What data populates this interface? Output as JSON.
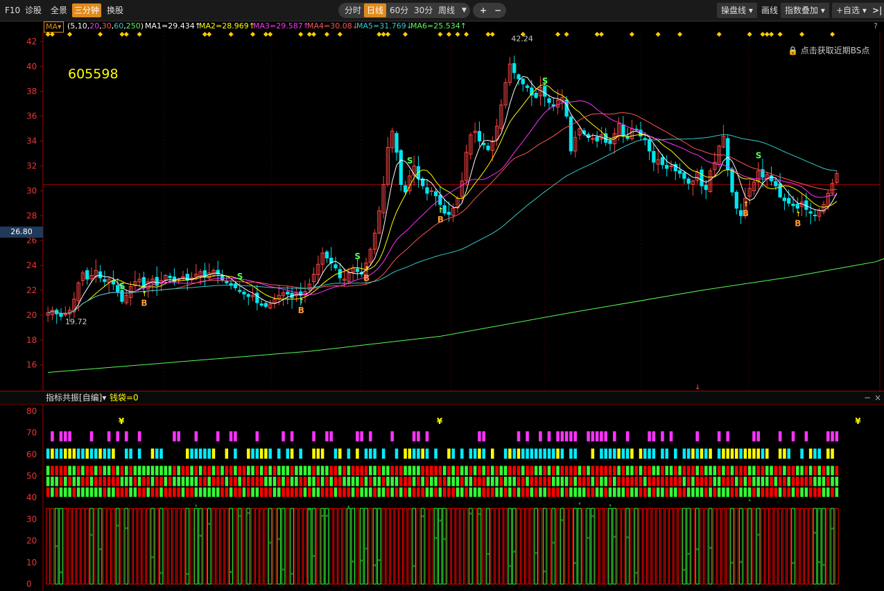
{
  "toolbar": {
    "left_items": [
      "F10",
      "诊股",
      "全景",
      "三分钟",
      "换股"
    ],
    "active_left": "三分钟",
    "periods": [
      "分时",
      "日线",
      "60分",
      "30分",
      "周线"
    ],
    "selected_period": "日线",
    "zoom_in": "+",
    "zoom_out": "−",
    "right_buttons": [
      "操盘线",
      "画线",
      "指数叠加",
      "+自选"
    ],
    "expand": ">|"
  },
  "ma_bar": {
    "indicator": "MA",
    "params_prefix": "(5,10,",
    "p3": "20",
    "p4": "30",
    "p5": "60",
    "p6": "250",
    "params_suffix": ")",
    "ma1": "MA1=29.434↑",
    "ma2": "MA2=28.969↑",
    "ma3": "MA3=29.587↑",
    "ma4": "MA4=30.08↓",
    "ma5": "MA5=31.769↓",
    "ma6": "MA6=25.534↑",
    "help": "?"
  },
  "stock_code": "605598",
  "bs_hint": "点击获取近期BS点",
  "current_price_tag": "26.80",
  "price_axis": [
    "42",
    "40",
    "38",
    "36",
    "34",
    "32",
    "30",
    "28",
    "26",
    "24",
    "22",
    "20",
    "18",
    "16"
  ],
  "extremes": {
    "high": "42.24",
    "low": "19.72"
  },
  "signal_labels": {
    "buy": "B",
    "sell": "S"
  },
  "indicator_bar": {
    "name": "指标共振[自编]",
    "value": "钱袋=0",
    "minimize": "−",
    "close": "×"
  },
  "indicator_axis": [
    "80",
    "70",
    "60",
    "50",
    "40",
    "30",
    "20",
    "10",
    "0"
  ],
  "yen_mark": "¥",
  "colors": {
    "up": "#ff4444",
    "down": "#00e5ee",
    "ma1": "#ffffff",
    "ma2": "#ffff00",
    "ma3": "#ff33ff",
    "ma4": "#ff5555",
    "ma5": "#33cccc",
    "ma6": "#55ff55",
    "accent": "#e08a1e"
  },
  "chart_data": {
    "type": "candlestick",
    "ylim": [
      15,
      43
    ],
    "closes": [
      20.2,
      20.4,
      20.1,
      19.9,
      20.1,
      20.4,
      21.3,
      22.6,
      23.4,
      22.9,
      23.2,
      23.6,
      23.0,
      22.7,
      22.9,
      22.5,
      21.9,
      21.1,
      21.6,
      22.3,
      22.7,
      22.9,
      22.2,
      22.7,
      22.9,
      22.4,
      22.8,
      23.2,
      23.0,
      22.7,
      22.9,
      23.1,
      22.8,
      23.0,
      23.3,
      23.5,
      23.1,
      23.4,
      23.6,
      23.3,
      22.8,
      22.6,
      22.4,
      22.2,
      21.9,
      21.7,
      21.5,
      21.6,
      21.0,
      20.8,
      20.7,
      20.9,
      21.3,
      21.6,
      21.8,
      21.7,
      21.4,
      21.8,
      21.6,
      21.9,
      22.5,
      23.3,
      24.1,
      25.0,
      24.6,
      24.2,
      23.8,
      23.0,
      22.9,
      23.4,
      23.8,
      23.5,
      23.3,
      24.2,
      25.3,
      26.6,
      28.4,
      30.5,
      33.5,
      34.8,
      33.1,
      30.5,
      29.9,
      31.2,
      32.0,
      31.0,
      30.4,
      29.8,
      30.0,
      29.6,
      28.9,
      28.2,
      28.1,
      28.6,
      29.4,
      30.8,
      33.1,
      34.5,
      34.8,
      34.0,
      33.7,
      33.3,
      34.0,
      35.2,
      36.9,
      38.7,
      40.2,
      39.5,
      39.0,
      38.6,
      38.3,
      37.7,
      37.5,
      38.3,
      37.6,
      37.1,
      36.8,
      37.3,
      37.5,
      36.0,
      33.2,
      34.3,
      35.0,
      34.6,
      34.3,
      34.2,
      34.0,
      34.5,
      33.9,
      33.8,
      34.6,
      35.4,
      34.5,
      34.2,
      35.0,
      34.9,
      34.4,
      34.1,
      33.2,
      32.3,
      32.5,
      32.1,
      31.8,
      32.0,
      31.6,
      31.4,
      31.0,
      30.6,
      30.8,
      31.5,
      30.4,
      30.1,
      31.6,
      32.3,
      33.6,
      34.4,
      31.7,
      29.9,
      28.6,
      28.0,
      29.4,
      30.2,
      30.7,
      31.6,
      31.1,
      31.3,
      30.8,
      30.4,
      29.5,
      29.2,
      29.0,
      28.8,
      28.6,
      29.1,
      28.5,
      28.2,
      28.0,
      28.4,
      28.9,
      29.8,
      30.6,
      31.4
    ],
    "ma6": [
      {
        "x": 0,
        "y": 15.4
      },
      {
        "x": 60,
        "y": 17.1
      },
      {
        "x": 90,
        "y": 18.3
      },
      {
        "x": 120,
        "y": 20.2
      },
      {
        "x": 150,
        "y": 22.0
      },
      {
        "x": 171,
        "y": 23.1
      },
      {
        "x": 190,
        "y": 24.3
      },
      {
        "x": 199,
        "y": 25.5
      }
    ],
    "buy_points": [
      22,
      58,
      73,
      90,
      160,
      172
    ],
    "sell_points": [
      17,
      44,
      71,
      83,
      114,
      163
    ]
  }
}
